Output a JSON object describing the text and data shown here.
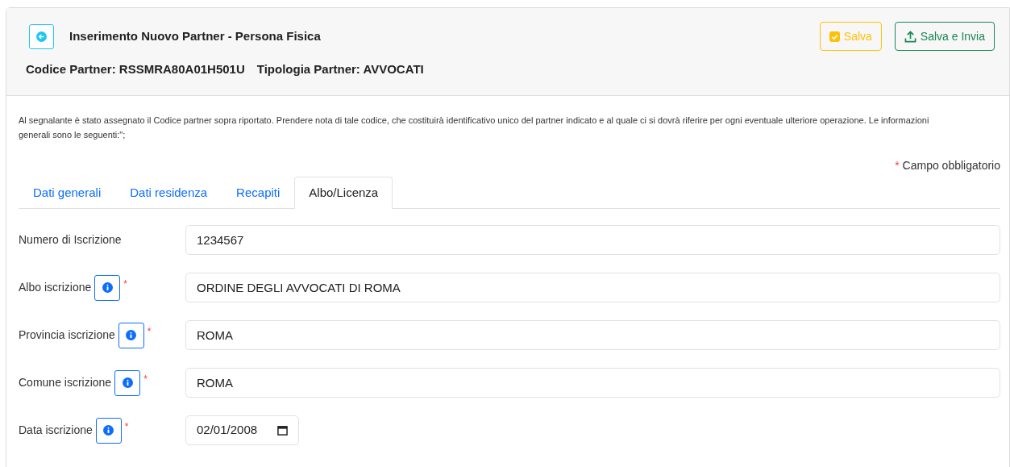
{
  "header": {
    "title": "Inserimento Nuovo Partner - Persona Fisica",
    "partner_code": "Codice Partner: RSSMRA80A01H501U",
    "partner_type": "Tipologia Partner: AVVOCATI",
    "buttons": [
      {
        "label": "Salva",
        "kind": "save"
      },
      {
        "label": "Salva e Invia",
        "kind": "send"
      }
    ]
  },
  "notice": "Al segnalante è stato assegnato il Codice partner sopra riportato. Prendere nota di tale codice, che costituirà identificativo unico del partner indicato e al quale ci si dovrà riferire per ogni eventuale ulteriore operazione. Le informazioni generali sono le seguenti:\";",
  "legend": {
    "mark": "*",
    "text": "Campo obbligatorio"
  },
  "tabs": [
    {
      "label": "Dati generali",
      "selected": false
    },
    {
      "label": "Dati residenza",
      "selected": false
    },
    {
      "label": "Recapiti",
      "selected": false
    },
    {
      "label": "Albo/Licenza",
      "selected": true
    }
  ],
  "fields": [
    {
      "label": "Numero di Iscrizione",
      "kind": "text",
      "value": "1234567",
      "info": false
    },
    {
      "label": "Albo iscrizione",
      "kind": "text",
      "value": "ORDINE DEGLI AVVOCATI DI ROMA",
      "info": true,
      "required_mark": "*"
    },
    {
      "label": "Provincia iscrizione",
      "kind": "text",
      "value": "ROMA",
      "info": true,
      "required_mark": "*"
    },
    {
      "label": "Comune iscrizione",
      "kind": "text",
      "value": "ROMA",
      "info": true,
      "required_mark": "*"
    },
    {
      "label": "Data iscrizione",
      "kind": "date",
      "value": "02/01/2008",
      "info": true,
      "required_mark": "*"
    }
  ]
}
